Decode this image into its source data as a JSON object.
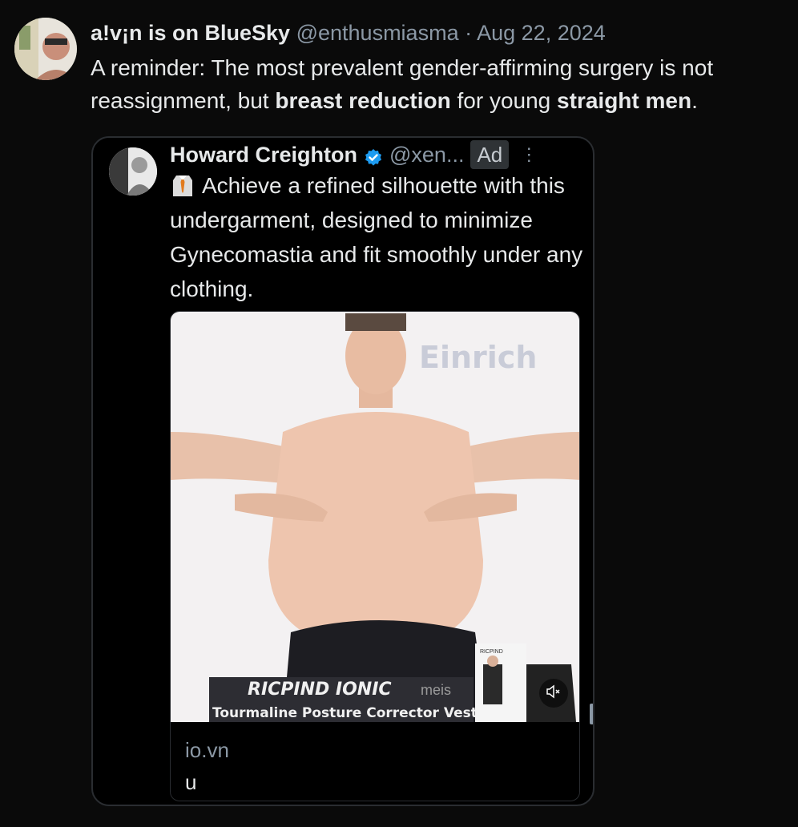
{
  "author": {
    "name": "a!v¡n is on BlueSky",
    "handle": "@enthusmiasma",
    "separator": "·",
    "date": "Aug 22, 2024"
  },
  "post": {
    "text_1": "A reminder: The most prevalent gender-affirming surgery is not reassignment, but ",
    "bold_1": "breast reduction",
    "text_2": " for young ",
    "bold_2": "straight men",
    "text_3": "."
  },
  "quoted": {
    "name": "Howard Creighton",
    "handle": "@xen...",
    "ad_label": "Ad",
    "more_label": "⋮",
    "text": "Achieve a refined silhouette with this undergarment, designed to minimize Gynecomastia and fit smoothly under any clothing.",
    "media": {
      "watermark": "Einrich",
      "brand": "RICPIND IONIC",
      "brand_suffix": "meis",
      "product": "Tourmaline Posture Corrector Vest",
      "thumb_label": "RICPIND"
    },
    "card": {
      "domain": "io.vn",
      "title": "u"
    }
  },
  "icons": {
    "verified": "verified-badge-icon",
    "tie": "necktie-shirt-icon",
    "mute": "speaker-muted-icon"
  },
  "colors": {
    "background": "#0a0a0a",
    "text": "#e7e9ea",
    "muted": "#8b98a5",
    "verified": "#1d9bf0"
  }
}
